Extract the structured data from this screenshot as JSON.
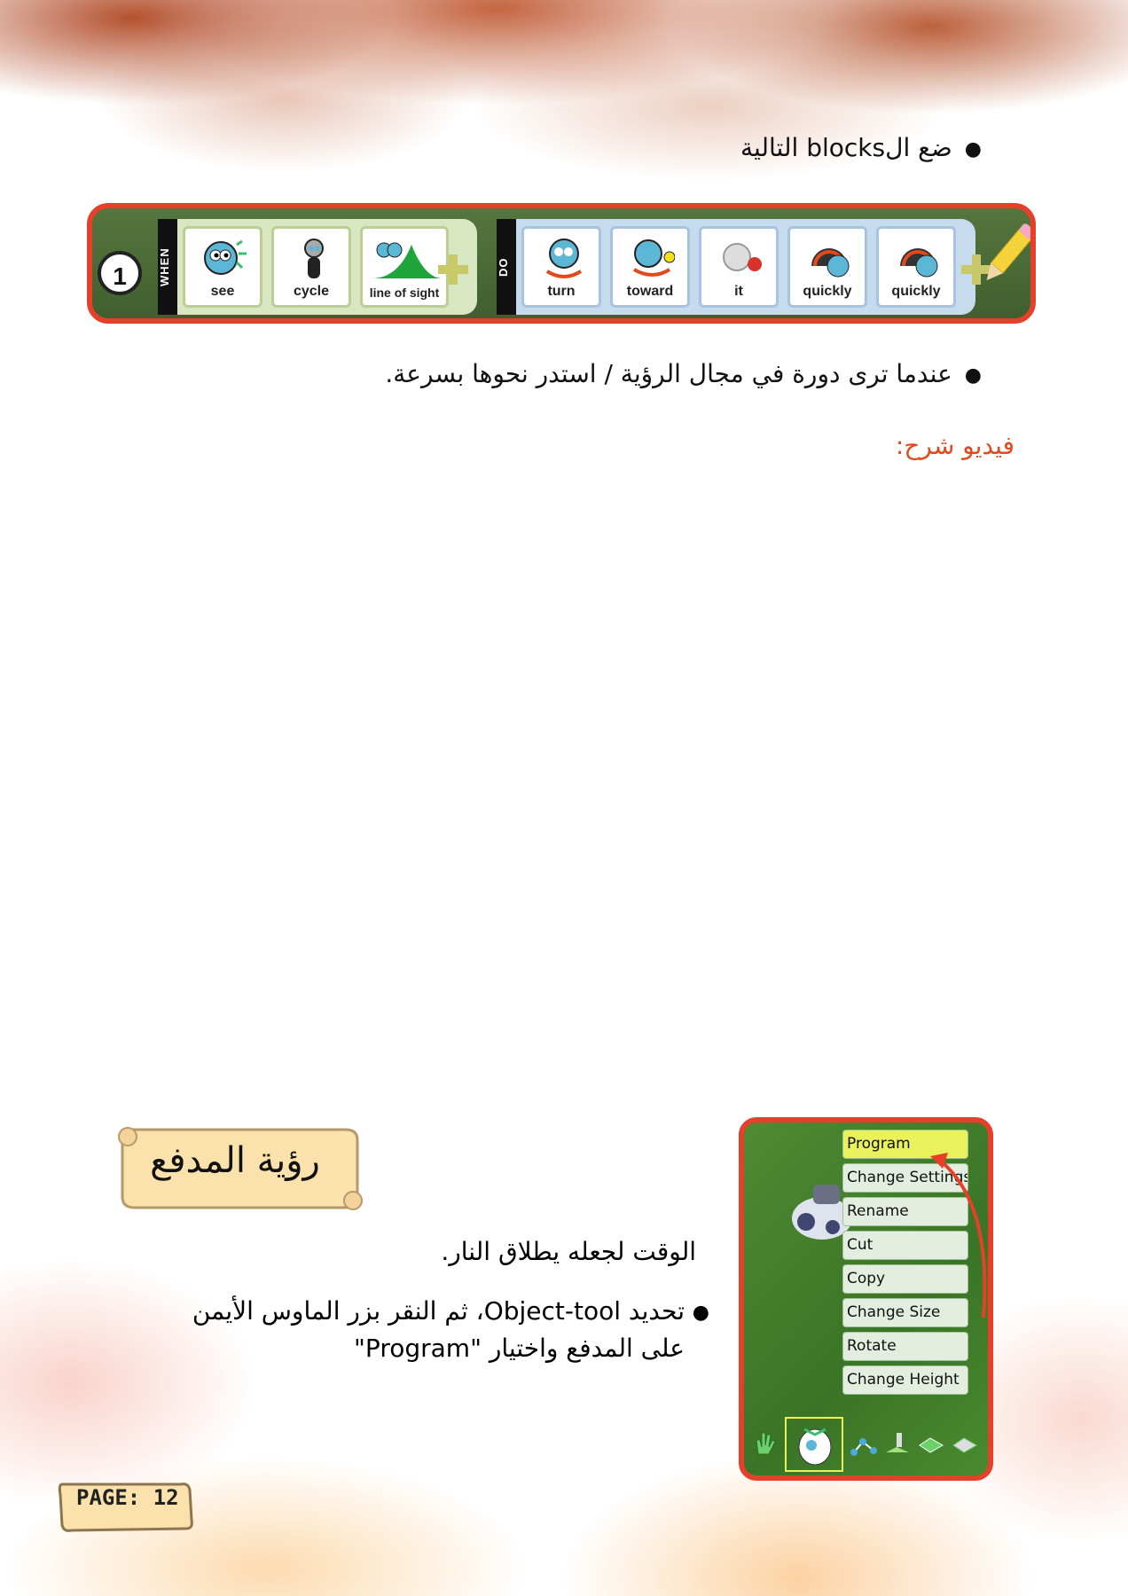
{
  "bullet1": "ضع الblocks التالية",
  "bullet2": "عندما ترى دورة في مجال الرؤية / استدر نحوها بسرعة.",
  "video_label": "فيديو شرح:",
  "code": {
    "row_number": "1",
    "when_tag": "WHEN",
    "do_tag": "DO",
    "when_tiles": [
      "see",
      "cycle",
      "line of sight"
    ],
    "do_tiles": [
      "turn",
      "toward",
      "it",
      "quickly",
      "quickly"
    ]
  },
  "section_title": "رؤية المدفع",
  "paragraph1": "الوقت لجعله يطلاق النار.",
  "paragraph2": "تحديد Object-tool، ثم النقر بزر الماوس الأيمن على المدفع واختيار \"Program\"",
  "menu": {
    "items": [
      "Program",
      "Change Settings",
      "Rename",
      "Cut",
      "Copy",
      "Change Size",
      "Rotate",
      "Change Height"
    ]
  },
  "page_label": "PAGE: 12",
  "colors": {
    "accent": "#e6402a",
    "video_label": "#e24a1d"
  }
}
